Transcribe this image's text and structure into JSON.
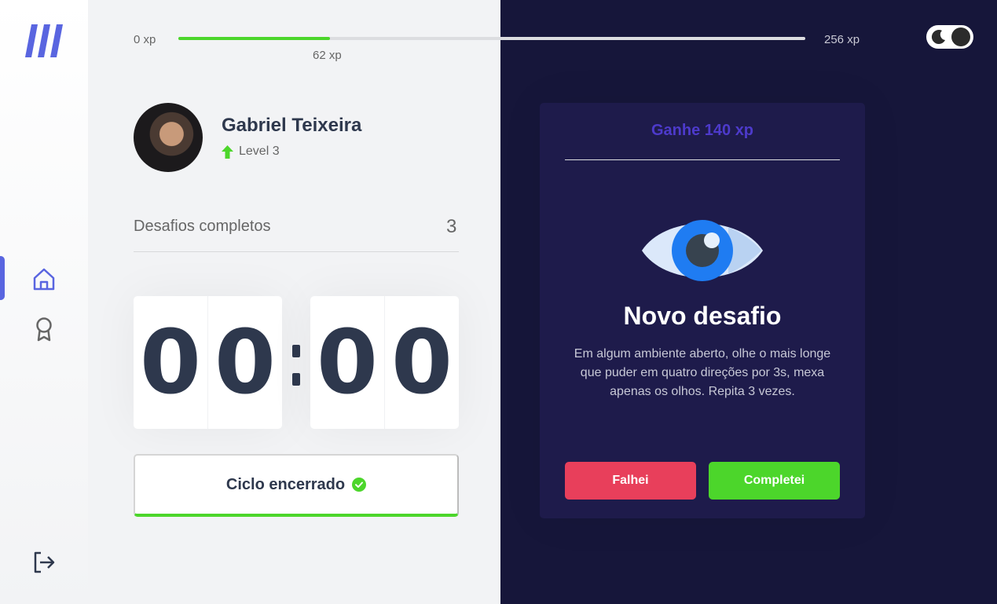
{
  "app": {
    "logo_icon": "moveit-logo-icon",
    "colors": {
      "accent": "#5965e0",
      "success": "#4cd62b",
      "danger": "#e83f5b",
      "dark_background": "#16163a",
      "card_background": "#1e1b4b",
      "challenge_header": "#4d3acb"
    }
  },
  "sidebar": {
    "items": [
      {
        "name": "home",
        "icon": "home-icon",
        "active": true
      },
      {
        "name": "awards",
        "icon": "award-icon",
        "active": false
      }
    ],
    "logout_icon": "logout-icon"
  },
  "xp_bar": {
    "start_label": "0 xp",
    "end_label": "256 xp",
    "current_label": "62 xp",
    "current_xp": 62,
    "max_xp": 256
  },
  "theme_toggle": {
    "icon": "moon-icon",
    "mode": "dark"
  },
  "profile": {
    "name": "Gabriel Teixeira",
    "level_icon": "level-up-arrow-icon",
    "level_text": "Level 3"
  },
  "completed_challenges": {
    "label": "Desafios completos",
    "count": "3"
  },
  "countdown": {
    "minute_left": "0",
    "minute_right": "0",
    "second_left": "0",
    "second_right": "0"
  },
  "cycle_button": {
    "label": "Ciclo encerrado",
    "icon": "check-circle-icon"
  },
  "challenge": {
    "header": "Ganhe 140 xp",
    "icon": "eye-icon",
    "title": "Novo desafio",
    "description": "Em algum ambiente aberto, olhe o mais longe que puder em quatro direções por 3s, mexa apenas os olhos. Repita 3 vezes.",
    "fail_label": "Falhei",
    "success_label": "Completei"
  }
}
